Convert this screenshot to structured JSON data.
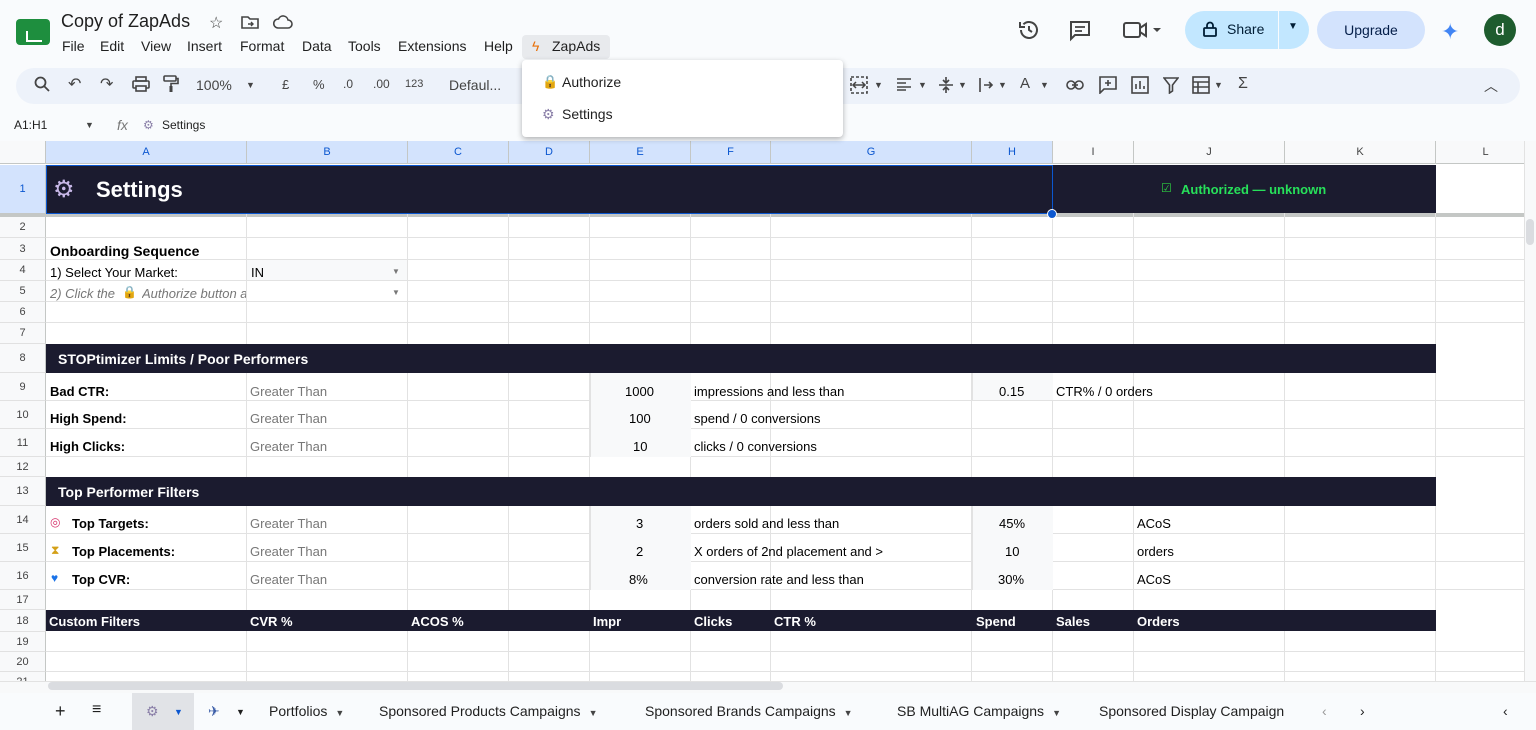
{
  "app": {
    "doc_title": "Copy of ZapAds",
    "menus": [
      "File",
      "Edit",
      "View",
      "Insert",
      "Format",
      "Data",
      "Tools",
      "Extensions",
      "Help",
      "ZapAds"
    ],
    "share_label": "Share",
    "upgrade_label": "Upgrade",
    "avatar_letter": "d"
  },
  "toolbar": {
    "zoom": "100%",
    "currency": "£",
    "percent": "%",
    "dec_decrease": ".0",
    "dec_increase": ".00",
    "number_format": "123",
    "font": "Defaul..."
  },
  "formula_bar": {
    "name_box": "A1:H1",
    "fx": "fx",
    "value": "Settings"
  },
  "zapads_menu": {
    "items": [
      {
        "icon": "lock-icon",
        "label": "Authorize"
      },
      {
        "icon": "gear-icon",
        "label": "Settings"
      }
    ]
  },
  "grid": {
    "columns": [
      "A",
      "B",
      "C",
      "D",
      "E",
      "F",
      "G",
      "H",
      "I",
      "J",
      "K",
      "L"
    ],
    "rows": [
      "1",
      "2",
      "3",
      "4",
      "5",
      "6",
      "7",
      "8",
      "9",
      "10",
      "11",
      "12",
      "13",
      "14",
      "15",
      "16",
      "17",
      "18",
      "19",
      "20",
      "21"
    ],
    "row1": {
      "title": "Settings",
      "status": "Authorized — unknown"
    },
    "onboarding": {
      "heading": "Onboarding Sequence",
      "step1_label": "1) Select Your Market:",
      "step1_value": "IN",
      "step2_label_a": "2) Click the",
      "step2_label_b": "Authorize button a"
    },
    "stoptimizer": {
      "heading": "STOPtimizer Limits / Poor Performers",
      "rows": [
        {
          "label": "Bad CTR:",
          "op": "Greater Than",
          "value": "1000",
          "desc": "impressions and less than",
          "value2": "0.15",
          "suffix": "CTR% / 0 orders"
        },
        {
          "label": "High Spend:",
          "op": "Greater Than",
          "value": "100",
          "desc": "spend / 0 conversions"
        },
        {
          "label": "High Clicks:",
          "op": "Greater Than",
          "value": "10",
          "desc": "clicks / 0 conversions"
        }
      ]
    },
    "top_performers": {
      "heading": "Top Performer Filters",
      "rows": [
        {
          "label": "Top Targets:",
          "op": "Greater Than",
          "value": "3",
          "desc": "orders sold and less than",
          "value2": "45%",
          "suffix": "ACoS"
        },
        {
          "label": "Top Placements:",
          "op": "Greater Than",
          "value": "2",
          "desc": "X orders of 2nd placement and >",
          "value2": "10",
          "suffix": "orders"
        },
        {
          "label": "Top CVR:",
          "op": "Greater Than",
          "value": "8%",
          "desc": "conversion rate and less than",
          "value2": "30%",
          "suffix": "ACoS"
        }
      ]
    },
    "custom_filters_header": [
      "Custom Filters",
      "CVR %",
      "ACOS %",
      "Impr",
      "Clicks",
      "CTR %",
      "Spend",
      "Sales",
      "Orders"
    ]
  },
  "sheet_tabs": [
    "Portfolios",
    "Sponsored Products Campaigns",
    "Sponsored Brands Campaigns",
    "SB MultiAG Campaigns",
    "Sponsored Display Campaign"
  ]
}
